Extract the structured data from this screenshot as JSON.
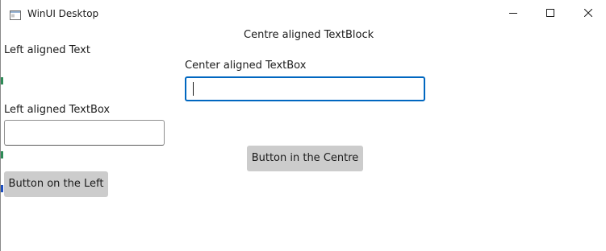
{
  "window": {
    "title": "WinUI Desktop",
    "app_icon": "window-app-icon",
    "caption_buttons": {
      "minimize_icon": "minimize-icon",
      "maximize_icon": "maximize-icon",
      "close_icon": "close-icon"
    }
  },
  "content": {
    "centre_textblock": "Centre aligned TextBlock",
    "left_text": "Left aligned Text",
    "center_textbox_label": "Center aligned TextBox",
    "center_textbox_value": "",
    "left_textbox_label": "Left aligned TextBox",
    "left_textbox_value": "",
    "button_centre_label": "Button in the Centre",
    "button_left_label": "Button on the Left"
  },
  "colors": {
    "accent_focus_border": "#0067c0",
    "button_background": "#cccccc",
    "text": "#1b1b1b"
  }
}
